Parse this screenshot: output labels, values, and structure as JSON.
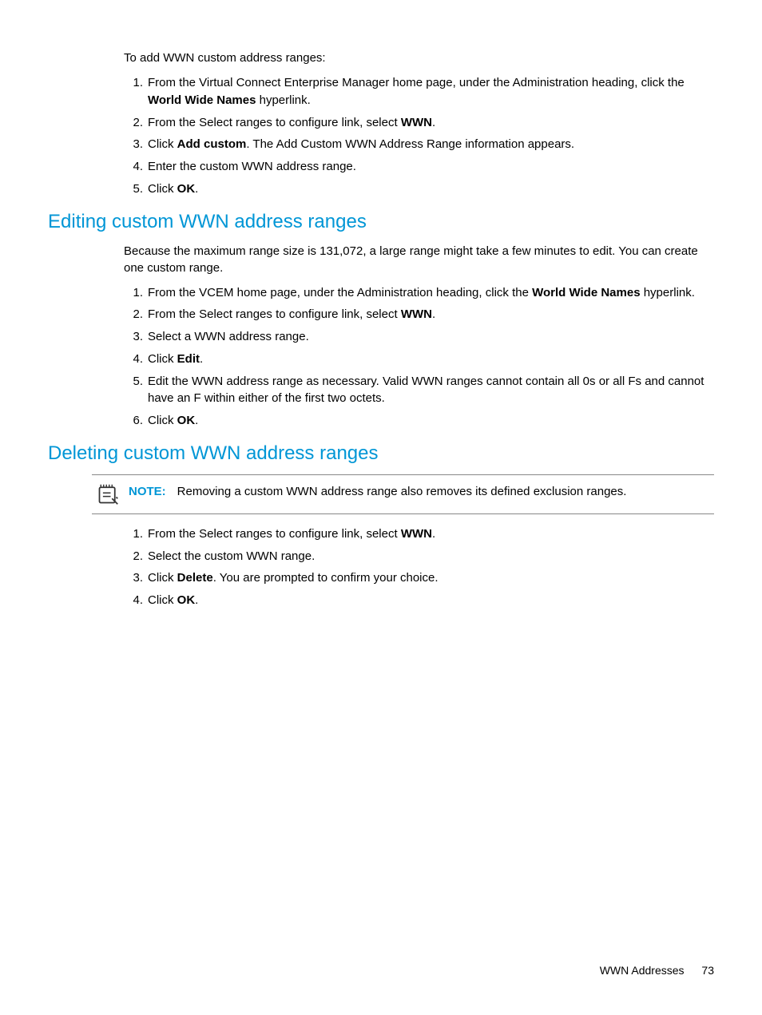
{
  "intro": {
    "lead": "To add WWN custom address ranges:",
    "steps": [
      {
        "pre": "From the Virtual Connect Enterprise Manager home page, under the Administration heading, click the ",
        "bold": "World Wide Names",
        "post": " hyperlink."
      },
      {
        "pre": "From the Select ranges to configure link, select ",
        "bold": "WWN",
        "post": "."
      },
      {
        "pre": "Click ",
        "bold": "Add custom",
        "post": ". The Add Custom WWN Address Range information appears."
      },
      {
        "pre": "Enter the custom WWN address range.",
        "bold": "",
        "post": ""
      },
      {
        "pre": "Click ",
        "bold": "OK",
        "post": "."
      }
    ]
  },
  "editing": {
    "heading": "Editing custom WWN address ranges",
    "lead": "Because the maximum range size is 131,072, a large range might take a few minutes to edit. You can create one custom range.",
    "steps": [
      {
        "pre": "From the VCEM home page, under the Administration heading, click the ",
        "bold": "World Wide Names",
        "post": " hyperlink."
      },
      {
        "pre": "From the Select ranges to configure link, select ",
        "bold": "WWN",
        "post": "."
      },
      {
        "pre": "Select a WWN address range.",
        "bold": "",
        "post": ""
      },
      {
        "pre": "Click ",
        "bold": "Edit",
        "post": "."
      },
      {
        "pre": "Edit the WWN address range as necessary. Valid WWN ranges cannot contain all 0s or all Fs and cannot have an F within either of the first two octets.",
        "bold": "",
        "post": ""
      },
      {
        "pre": "Click ",
        "bold": "OK",
        "post": "."
      }
    ]
  },
  "deleting": {
    "heading": "Deleting custom WWN address ranges",
    "note_label": "NOTE:",
    "note_text": "Removing a custom WWN address range also removes its defined exclusion ranges.",
    "steps": [
      {
        "pre": "From the Select ranges to configure link, select ",
        "bold": "WWN",
        "post": "."
      },
      {
        "pre": "Select the custom WWN range.",
        "bold": "",
        "post": ""
      },
      {
        "pre": "Click ",
        "bold": "Delete",
        "post": ". You are prompted to confirm your choice."
      },
      {
        "pre": "Click ",
        "bold": "OK",
        "post": "."
      }
    ]
  },
  "footer": {
    "section": "WWN Addresses",
    "page": "73"
  }
}
